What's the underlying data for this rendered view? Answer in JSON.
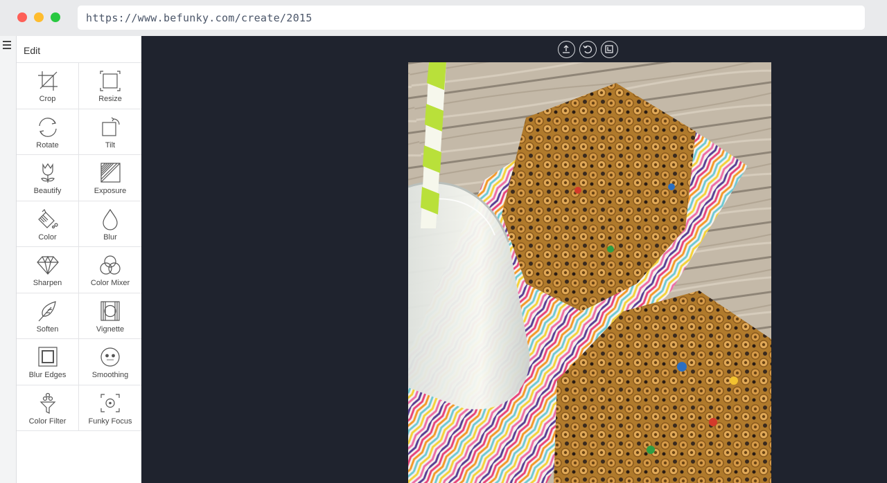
{
  "browser": {
    "url": "https://www.befunky.com/create/2015"
  },
  "panel": {
    "title": "Edit",
    "tools": [
      {
        "label": "Crop",
        "icon": "crop-icon"
      },
      {
        "label": "Resize",
        "icon": "resize-icon"
      },
      {
        "label": "Rotate",
        "icon": "rotate-icon"
      },
      {
        "label": "Tilt",
        "icon": "tilt-icon"
      },
      {
        "label": "Beautify",
        "icon": "beautify-flower-icon"
      },
      {
        "label": "Exposure",
        "icon": "exposure-icon"
      },
      {
        "label": "Color",
        "icon": "color-bucket-icon"
      },
      {
        "label": "Blur",
        "icon": "blur-drop-icon"
      },
      {
        "label": "Sharpen",
        "icon": "sharpen-diamond-icon"
      },
      {
        "label": "Color Mixer",
        "icon": "color-mixer-icon"
      },
      {
        "label": "Soften",
        "icon": "soften-feather-icon"
      },
      {
        "label": "Vignette",
        "icon": "vignette-icon"
      },
      {
        "label": "Blur Edges",
        "icon": "blur-edges-icon"
      },
      {
        "label": "Smoothing",
        "icon": "smoothing-face-icon"
      },
      {
        "label": "Color Filter",
        "icon": "color-filter-icon"
      },
      {
        "label": "Funky Focus",
        "icon": "funky-focus-icon"
      }
    ]
  },
  "canvas_toolbar": {
    "buttons": [
      "upload-icon",
      "undo-icon",
      "layers-icon"
    ]
  },
  "colors": {
    "canvas_bg": "#1f232e",
    "panel_bg": "#ffffff",
    "straw_green": "#b9e03a"
  }
}
